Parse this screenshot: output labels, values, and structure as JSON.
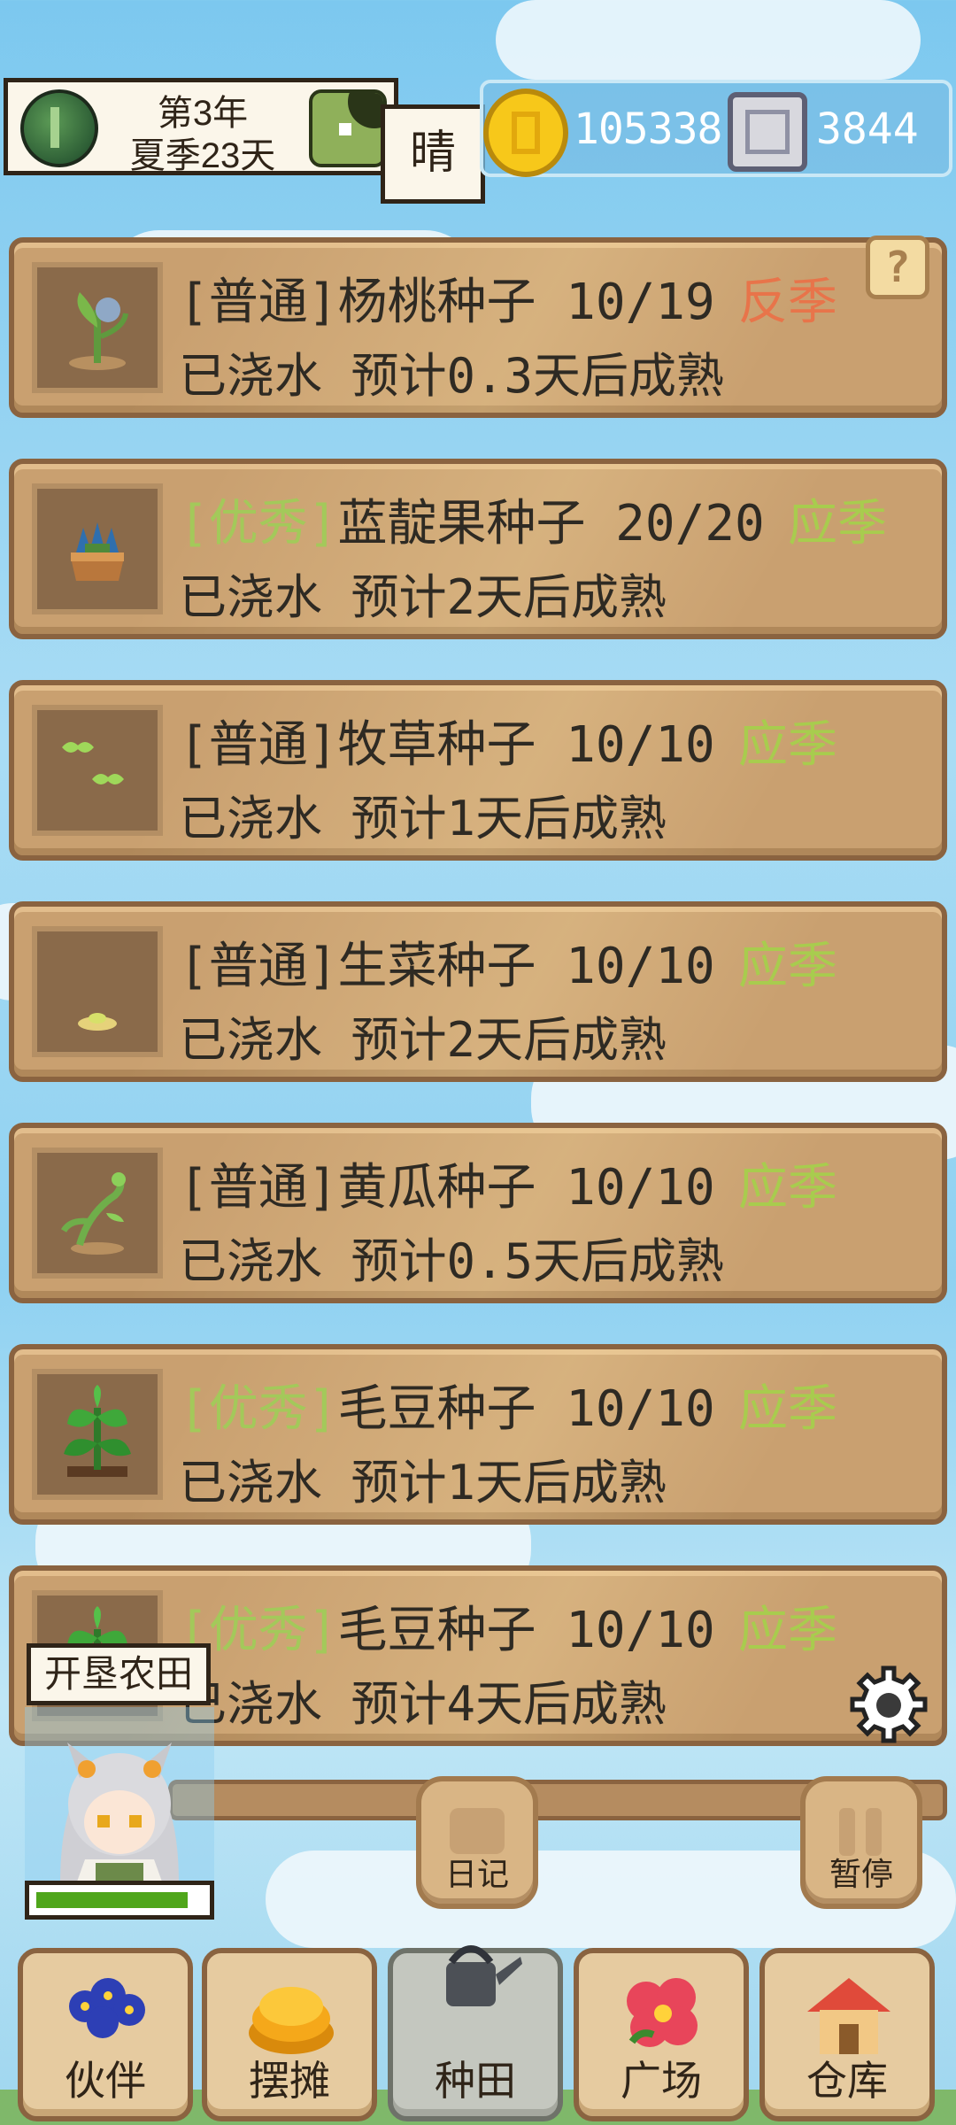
{
  "header": {
    "year": "第3年",
    "season_day": "夏季23天",
    "weather": "晴",
    "coins": "105338",
    "gems": "3844"
  },
  "help_label": "?",
  "crops": [
    {
      "tier": "[普通]",
      "tier_type": "normal",
      "name": "杨桃种子",
      "count": "10/19",
      "season": "反季",
      "status": "已浇水 预计0.3天后成熟",
      "icon": "starfruit-seedling-icon"
    },
    {
      "tier": "[优秀]",
      "tier_type": "excellent",
      "name": "蓝靛果种子",
      "count": "20/20",
      "season": "应季",
      "status": "已浇水 预计2天后成熟",
      "icon": "honeysuckle-berry-plant-icon"
    },
    {
      "tier": "[普通]",
      "tier_type": "normal",
      "name": "牧草种子",
      "count": "10/10",
      "season": "应季",
      "status": "已浇水 预计1天后成熟",
      "icon": "grass-sprout-icon"
    },
    {
      "tier": "[普通]",
      "tier_type": "normal",
      "name": "生菜种子",
      "count": "10/10",
      "season": "应季",
      "status": "已浇水 预计2天后成熟",
      "icon": "lettuce-seed-icon"
    },
    {
      "tier": "[普通]",
      "tier_type": "normal",
      "name": "黄瓜种子",
      "count": "10/10",
      "season": "应季",
      "status": "已浇水 预计0.5天后成熟",
      "icon": "cucumber-vine-icon"
    },
    {
      "tier": "[优秀]",
      "tier_type": "excellent",
      "name": "毛豆种子",
      "count": "10/10",
      "season": "应季",
      "status": "已浇水 预计1天后成熟",
      "icon": "soybean-plant-icon"
    },
    {
      "tier": "[优秀]",
      "tier_type": "excellent",
      "name": "毛豆种子",
      "count": "10/10",
      "season": "应季",
      "status": "已浇水 预计4天后成熟",
      "icon": "soybean-plant-icon"
    }
  ],
  "colors": {
    "off_season": "#e8744a",
    "in_season": "#a8cc4e",
    "excellent": "#a3c95a"
  },
  "character": {
    "activity": "开垦农田",
    "stamina_pct": 92
  },
  "controls": {
    "diary": "日记",
    "pause": "暂停"
  },
  "nav": [
    {
      "label": "伙伴",
      "icon": "blue-flower-icon"
    },
    {
      "label": "摆摊",
      "icon": "coin-pile-icon"
    },
    {
      "label": "种田",
      "icon": "watering-can-icon",
      "active": true
    },
    {
      "label": "广场",
      "icon": "red-flower-icon"
    },
    {
      "label": "仓库",
      "icon": "house-icon"
    }
  ]
}
